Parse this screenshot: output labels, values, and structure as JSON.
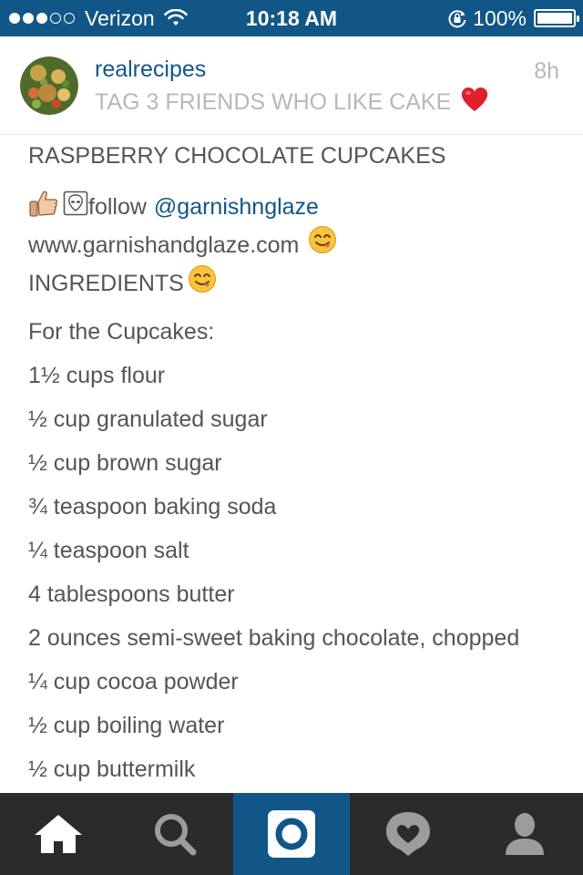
{
  "status_bar": {
    "carrier": "Verizon",
    "time": "10:18 AM",
    "battery_percent": "100%",
    "battery_level": 1.0,
    "signal_strength": 3,
    "signal_max": 5
  },
  "post": {
    "username": "realrecipes",
    "caption_short": "TAG 3 FRIENDS WHO LIKE CAKE",
    "timestamp": "8h",
    "title": "RASPBERRY CHOCOLATE CUPCAKES",
    "follow_text": "follow",
    "follow_handle": "@garnishnglaze",
    "website": "www.garnishandglaze.com",
    "ingredients_label": "INGREDIENTS",
    "section_label": "For the Cupcakes:",
    "items": [
      "1½ cups flour",
      "½ cup granulated sugar",
      "½ cup brown sugar",
      "¾ teaspoon baking soda",
      "¼ teaspoon salt",
      "4 tablespoons butter",
      "2 ounces semi-sweet baking chocolate, chopped",
      "¼ cup cocoa powder",
      "½ cup boiling water",
      "½ cup buttermilk"
    ]
  },
  "icons": {
    "heart": "red-heart-emoji",
    "thumbs_up": "thumbs-up-emoji",
    "alien": "alien-emoji",
    "yum": "yum-face-emoji"
  },
  "tabs": [
    "home",
    "search",
    "camera",
    "activity",
    "profile"
  ],
  "active_tab": "camera",
  "colors": {
    "brand_blue": "#125688",
    "tab_bar": "#2b2b2d",
    "text": "#555555",
    "muted": "#b8b8b8",
    "heart": "#e0202a"
  }
}
